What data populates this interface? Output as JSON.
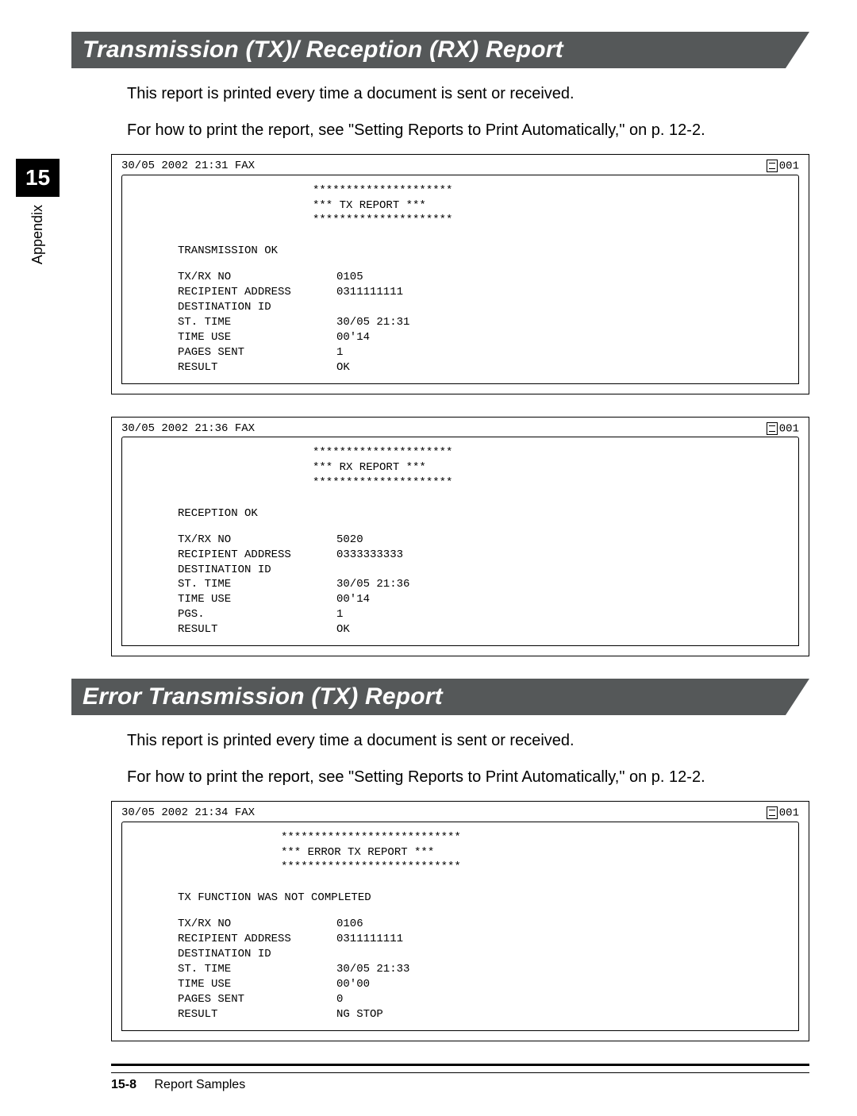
{
  "chapter_number": "15",
  "appendix_label": "Appendix",
  "section1": {
    "title": "Transmission (TX)/ Reception (RX) Report",
    "intro1": "This report is printed every time a document is sent or received.",
    "intro2": "For how to print the report, see \"Setting Reports to Print Automatically,\" on p. 12-2."
  },
  "report_tx": {
    "header_left": "30/05 2002 21:31 FAX",
    "header_right": "001",
    "title_border": "*********************",
    "title_line": "***   TX REPORT   ***",
    "status": "TRANSMISSION OK",
    "rows": [
      {
        "lab": "TX/RX NO",
        "val": "0105"
      },
      {
        "lab": "RECIPIENT ADDRESS",
        "val": "0311111111"
      },
      {
        "lab": "DESTINATION ID",
        "val": ""
      },
      {
        "lab": "ST. TIME",
        "val": "30/05 21:31"
      },
      {
        "lab": "TIME USE",
        "val": "00'14"
      },
      {
        "lab": "PAGES SENT",
        "val": "  1"
      },
      {
        "lab": "RESULT",
        "val": "OK"
      }
    ]
  },
  "report_rx": {
    "header_left": "30/05 2002 21:36 FAX",
    "header_right": "001",
    "title_border": "*********************",
    "title_line": "***   RX REPORT   ***",
    "status": "RECEPTION OK",
    "rows": [
      {
        "lab": "TX/RX NO",
        "val": "5020"
      },
      {
        "lab": "RECIPIENT ADDRESS",
        "val": "0333333333"
      },
      {
        "lab": "DESTINATION ID",
        "val": ""
      },
      {
        "lab": "ST. TIME",
        "val": "30/05 21:36"
      },
      {
        "lab": "TIME USE",
        "val": "00'14"
      },
      {
        "lab": "PGS.",
        "val": "  1"
      },
      {
        "lab": "RESULT",
        "val": "OK"
      }
    ]
  },
  "section2": {
    "title": "Error Transmission (TX) Report",
    "intro1": "This report is printed every time a document is sent or received.",
    "intro2": "For how to print the report, see \"Setting Reports to Print Automatically,\" on p. 12-2."
  },
  "report_err": {
    "header_left": "30/05 2002 21:34 FAX",
    "header_right": "001",
    "title_border": "***************************",
    "title_line": "***   ERROR TX REPORT   ***",
    "status": "TX FUNCTION WAS NOT COMPLETED",
    "rows": [
      {
        "lab": "TX/RX NO",
        "val": "0106"
      },
      {
        "lab": "RECIPIENT ADDRESS",
        "val": "0311111111"
      },
      {
        "lab": "DESTINATION ID",
        "val": ""
      },
      {
        "lab": "ST. TIME",
        "val": "30/05 21:33"
      },
      {
        "lab": "TIME USE",
        "val": "00'00"
      },
      {
        "lab": "PAGES SENT",
        "val": "  0"
      },
      {
        "lab": "RESULT",
        "val": "NG        STOP"
      }
    ]
  },
  "footer": {
    "page": "15-8",
    "label": "Report Samples"
  }
}
